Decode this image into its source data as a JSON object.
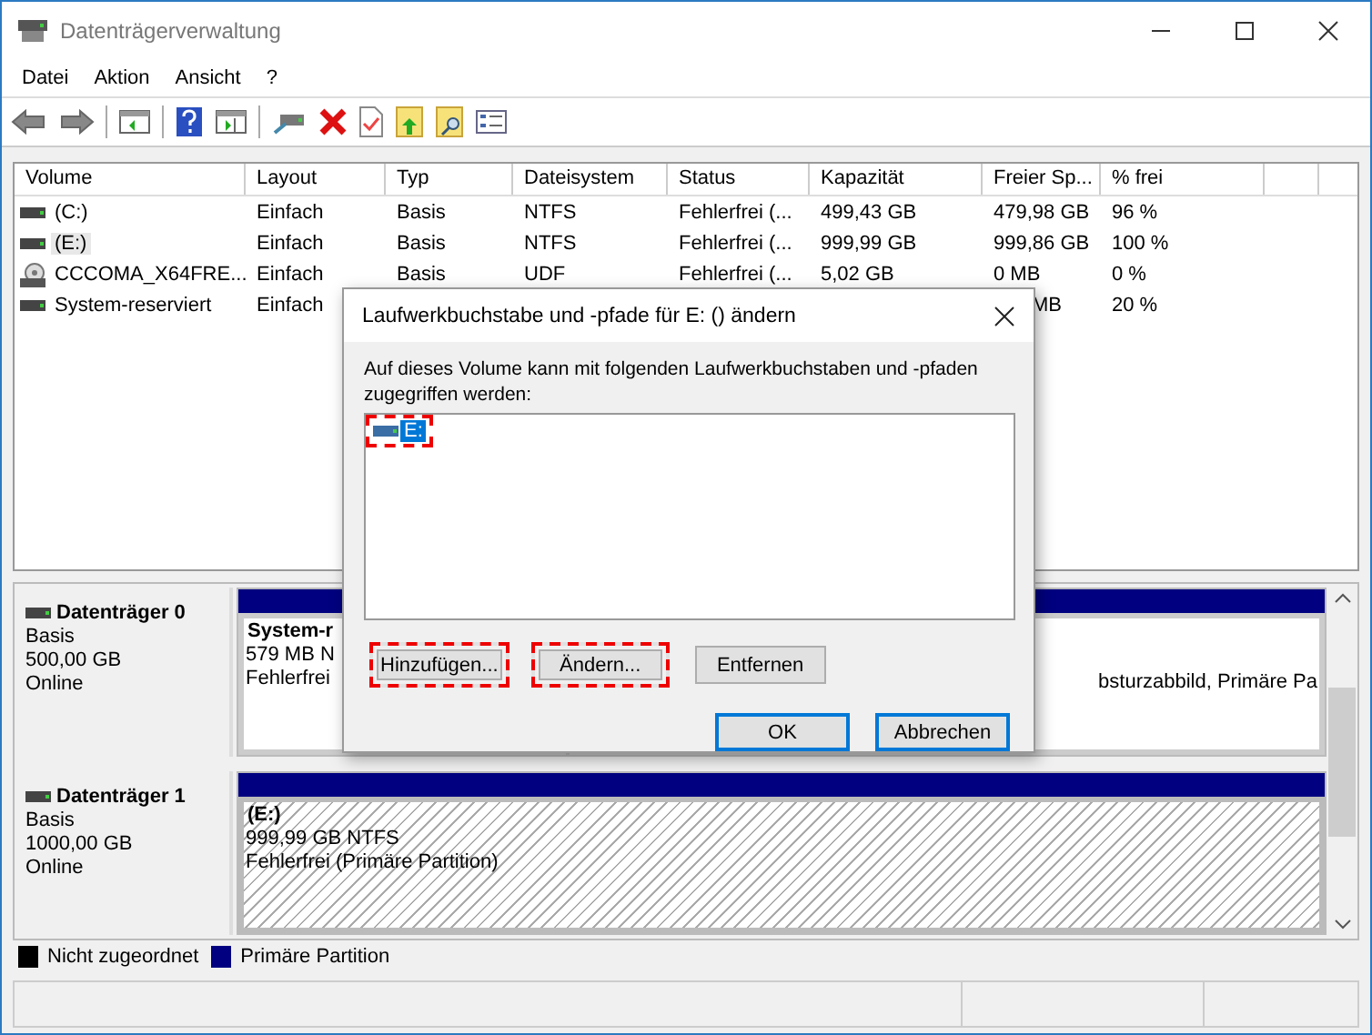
{
  "window": {
    "title": "Datenträgerverwaltung"
  },
  "menu": [
    "Datei",
    "Aktion",
    "Ansicht",
    "?"
  ],
  "toolbar": [
    {
      "kind": "back"
    },
    {
      "kind": "forward"
    },
    {
      "kind": "sep"
    },
    {
      "kind": "panel"
    },
    {
      "kind": "sep"
    },
    {
      "kind": "help"
    },
    {
      "kind": "panel2"
    },
    {
      "kind": "sep"
    },
    {
      "kind": "connect"
    },
    {
      "kind": "delete"
    },
    {
      "kind": "checkdoc"
    },
    {
      "kind": "folderup"
    },
    {
      "kind": "foldersearch"
    },
    {
      "kind": "list"
    }
  ],
  "table": {
    "columns": [
      "Volume",
      "Layout",
      "Typ",
      "Dateisystem",
      "Status",
      "Kapazität",
      "Freier Sp...",
      "% frei"
    ],
    "rows": [
      {
        "kind": "hdd",
        "selected": false,
        "cells": [
          "(C:)",
          "Einfach",
          "Basis",
          "NTFS",
          "Fehlerfrei (...",
          "499,43 GB",
          "479,98 GB",
          "96 %"
        ]
      },
      {
        "kind": "hdd",
        "selected": true,
        "cells": [
          "(E:)",
          "Einfach",
          "Basis",
          "NTFS",
          "Fehlerfrei (...",
          "999,99 GB",
          "999,86 GB",
          "100 %"
        ]
      },
      {
        "kind": "cd",
        "selected": false,
        "cells": [
          "CCCOMA_X64FRE...",
          "Einfach",
          "Basis",
          "UDF",
          "Fehlerfrei (...",
          "5,02 GB",
          "0 MB",
          "0 %"
        ]
      },
      {
        "kind": "hdd",
        "selected": false,
        "cells": [
          "System-reserviert",
          "Einfach",
          "",
          "",
          "",
          "",
          "MB",
          "20 %"
        ]
      }
    ]
  },
  "disks": [
    {
      "name": "Datenträger 0",
      "type": "Basis",
      "size": "500,00 GB",
      "state": "Online",
      "partitions": [
        {
          "kind": "primary",
          "lines": [
            "System-r",
            "579 MB N",
            "Fehlerfrei"
          ]
        },
        {
          "kind": "primary",
          "lines": [
            "bsturzabbild, Primäre Pa"
          ]
        }
      ]
    },
    {
      "name": "Datenträger 1",
      "type": "Basis",
      "size": "1000,00 GB",
      "state": "Online",
      "partitions": [
        {
          "kind": "selected",
          "lines": [
            "(E:)",
            "999,99 GB NTFS",
            "Fehlerfrei (Primäre Partition)"
          ]
        }
      ]
    }
  ],
  "legend": [
    {
      "label": "Nicht zugeordnet",
      "color": "#000000"
    },
    {
      "label": "Primäre Partition",
      "color": "#000080"
    }
  ],
  "dialog": {
    "title": "Laufwerkbuchstabe und -pfade für E: () ändern",
    "description": "Auf dieses Volume kann mit folgenden Laufwerkbuchstaben und -pfaden zugegriffen werden:",
    "paths": [
      {
        "label": "E:",
        "selected": true,
        "highlighted": true
      }
    ],
    "buttons": [
      {
        "label": "Hinzufügen...",
        "highlighted": true
      },
      {
        "label": "Ändern...",
        "highlighted": true
      },
      {
        "label": "Entfernen",
        "highlighted": false
      }
    ],
    "footer_buttons": [
      "OK",
      "Abbrechen"
    ]
  }
}
